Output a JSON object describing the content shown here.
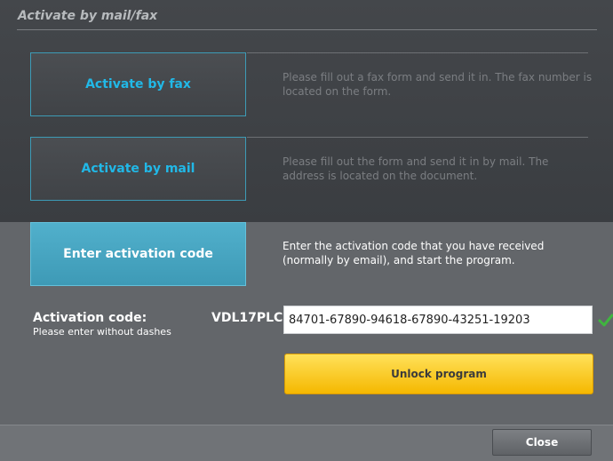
{
  "section": {
    "title": "Activate by mail/fax"
  },
  "options": [
    {
      "label": "Activate by fax",
      "description": "Please fill out a fax form and send it in. The fax number is located on the form."
    },
    {
      "label": "Activate by mail",
      "description": "Please fill out the form and send it in by mail. The address is located on the document."
    },
    {
      "label": "Enter activation code",
      "description": "Enter the activation code that you have received (normally by email), and start the program."
    }
  ],
  "activation": {
    "label": "Activation code:",
    "hint": "Please enter without dashes",
    "prefix": "VDL17PLC-",
    "value": "84701-67890-94618-67890-43251-19203",
    "valid_icon": "checkmark-icon"
  },
  "buttons": {
    "unlock": "Unlock program",
    "close": "Close"
  },
  "colors": {
    "accent": "#21b8e7",
    "active_tab": "#4aaac6",
    "unlock": "#fcc72a",
    "check": "#3fb53f"
  }
}
